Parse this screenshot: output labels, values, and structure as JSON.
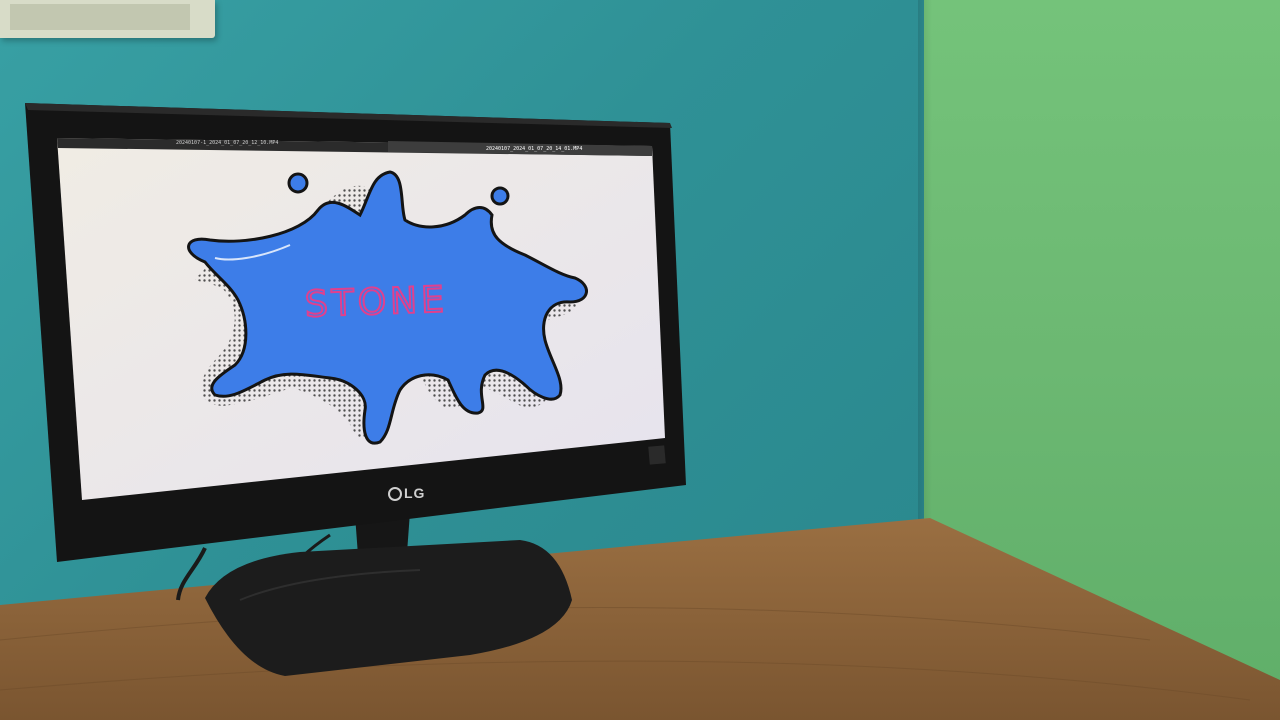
{
  "scene": {
    "description_label": "",
    "monitor": {
      "brand": "LG",
      "tabs": [
        {
          "label": "20240107-1_2024_01_07_20_12_10.MP4"
        },
        {
          "label": "20240107_2024_01_07_20_14_01.MP4"
        }
      ],
      "display_text": "STONE"
    },
    "colors": {
      "wall_teal": "#2f9196",
      "wall_green": "#6cb872",
      "desk_wood": "#8a6238",
      "splash_blue": "#3d7de8",
      "text_pink": "#e0408e"
    }
  }
}
